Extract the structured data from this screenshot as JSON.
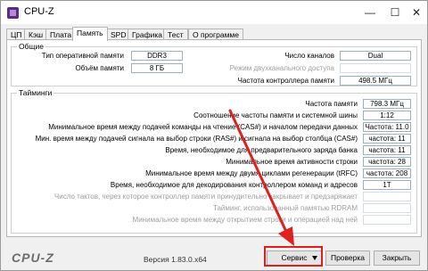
{
  "window": {
    "title": "CPU-Z"
  },
  "tabs": [
    {
      "label": "ЦП"
    },
    {
      "label": "Кэш"
    },
    {
      "label": "Плата"
    },
    {
      "label": "Память"
    },
    {
      "label": "SPD"
    },
    {
      "label": "Графика"
    },
    {
      "label": "Тест"
    },
    {
      "label": "О программе"
    }
  ],
  "general": {
    "title": "Общие",
    "type_label": "Тип оперативной памяти",
    "type_value": "DDR3",
    "size_label": "Объём памяти",
    "size_value": "8 ГБ",
    "channels_label": "Число каналов",
    "channels_value": "Dual",
    "dc_mode_label": "Режим двухканального доступа",
    "dc_mode_value": "",
    "nb_freq_label": "Частота контроллера памяти",
    "nb_freq_value": "498.5 МГц"
  },
  "timings": {
    "title": "Тайминги",
    "rows": [
      {
        "label": "Частота памяти",
        "value": "798.3 МГц",
        "dim": false
      },
      {
        "label": "Соотношение частоты памяти и системной шины",
        "value": "1:12",
        "dim": false
      },
      {
        "label": "Минимальное время между подачей команды на чтение (CAS#) и началом передачи данных",
        "value": "Частота: 11.0",
        "dim": false
      },
      {
        "label": "Мин. время между подачей сигнала на выбор строки (RAS#) и сигнала на выбор столбца (CAS#)",
        "value": "частота: 11",
        "dim": false
      },
      {
        "label": "Время, необходимое для предварительного заряда банка",
        "value": "частота: 11",
        "dim": false
      },
      {
        "label": "Минимальное время активности строки",
        "value": "частота: 28",
        "dim": false
      },
      {
        "label": "Минимальное время между двумя циклами регенерации (tRFC)",
        "value": "частота: 208",
        "dim": false
      },
      {
        "label": "Время, необходимое для декодирования контроллером команд и адресов",
        "value": "1T",
        "dim": false
      },
      {
        "label": "Число тактов, через которое контроллер памяти принудительно закрывает и предзаряжает",
        "value": "",
        "dim": true
      },
      {
        "label": "Тайминг, использованный памятью RDRAM",
        "value": "",
        "dim": true
      },
      {
        "label": "Минимальное время между открытием строки и операцией над ней",
        "value": "",
        "dim": true
      }
    ]
  },
  "footer": {
    "logo": "CPU-Z",
    "version": "Версия 1.83.0.x64",
    "service_label": "Сервис",
    "check_label": "Проверка",
    "close_label": "Закрыть"
  },
  "colors": {
    "annotation": "#e0201e"
  }
}
